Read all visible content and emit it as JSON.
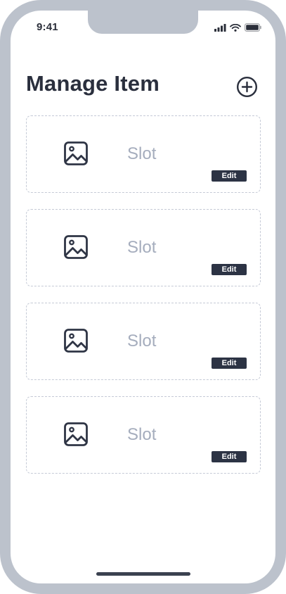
{
  "status_bar": {
    "time": "9:41",
    "icons": [
      "cellular-signal-icon",
      "wifi-icon",
      "battery-icon"
    ]
  },
  "header": {
    "title": "Manage Item",
    "add_icon": "plus-circle-icon"
  },
  "slots": [
    {
      "label": "Slot",
      "icon": "image-icon",
      "edit_label": "Edit"
    },
    {
      "label": "Slot",
      "icon": "image-icon",
      "edit_label": "Edit"
    },
    {
      "label": "Slot",
      "icon": "image-icon",
      "edit_label": "Edit"
    },
    {
      "label": "Slot",
      "icon": "image-icon",
      "edit_label": "Edit"
    }
  ],
  "colors": {
    "frame": "#bcc2cc",
    "title": "#2a2f3d",
    "slot_text": "#a5adbd",
    "dashed_border": "#c5cad6",
    "edit_button": "#2c3344"
  }
}
